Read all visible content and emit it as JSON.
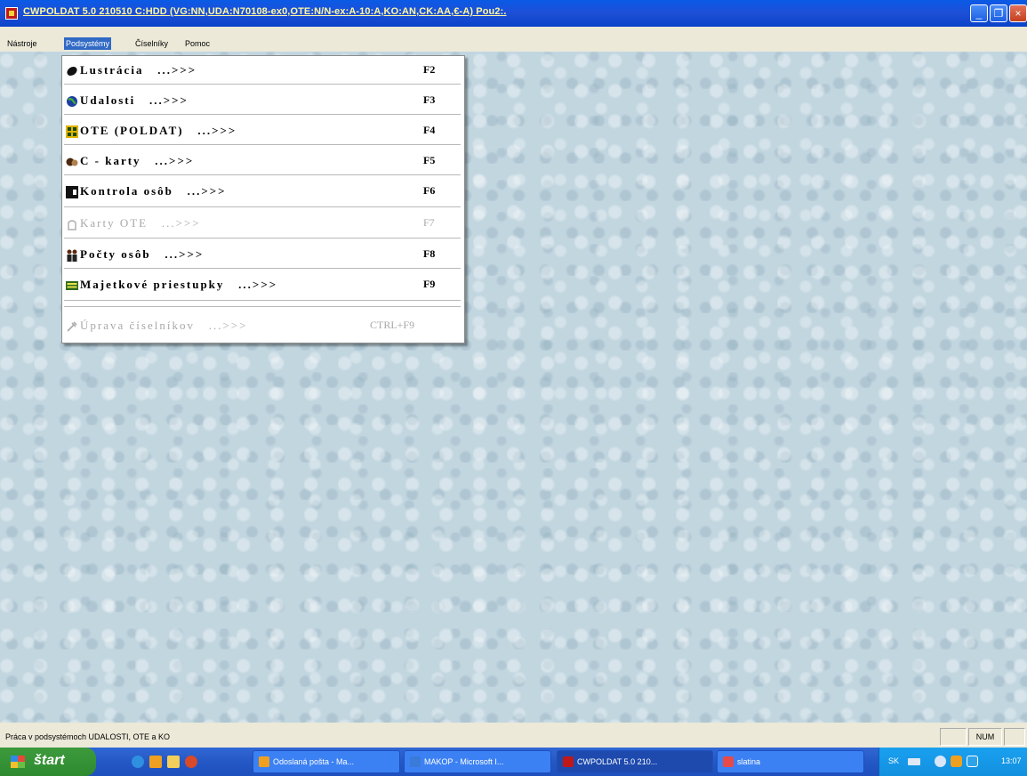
{
  "window": {
    "title": "CWPOLDAT 5.0 210510 C:HDD (VG:NN,UDA:N70108-ex0,OTE:N/N-ex:A-10:A,KO:AN,CK:AA,€-A) Pou2:."
  },
  "menubar": {
    "items": [
      "Nástroje",
      "Podsystémy",
      "Číselníky",
      "Pomoc"
    ],
    "active": "Podsystémy"
  },
  "dropdown": {
    "items": [
      {
        "label": "Lustrácia   ...>>>",
        "shortcut": "F2",
        "icon": "lustracia-icon",
        "enabled": true
      },
      {
        "label": "Udalosti   ...>>>",
        "shortcut": "F3",
        "icon": "globe-icon",
        "enabled": true
      },
      {
        "label": "OTE (POLDAT)   ...>>>",
        "shortcut": "F4",
        "icon": "ote-icon",
        "enabled": true
      },
      {
        "label": "C - karty   ...>>>",
        "shortcut": "F5",
        "icon": "ckarty-icon",
        "enabled": true
      },
      {
        "label": "Kontrola osôb   ...>>>",
        "shortcut": "F6",
        "icon": "kontrola-icon",
        "enabled": true
      },
      {
        "label": "Karty OTE   ...>>>",
        "shortcut": "F7",
        "icon": "karty-ote-icon",
        "enabled": false
      },
      {
        "label": "Počty osôb   ...>>>",
        "shortcut": "F8",
        "icon": "people-icon",
        "enabled": true
      },
      {
        "label": "Majetkové priestupky   ...>>>",
        "shortcut": "F9",
        "icon": "majetkove-icon",
        "enabled": true
      },
      {
        "label": "Úprava číselníkov   ...>>>",
        "shortcut": "CTRL+F9",
        "icon": "uprava-icon",
        "enabled": false
      }
    ]
  },
  "statusbar": {
    "text": "Práca v podsystémoch UDALOSTI, OTE a KO",
    "num": "NUM"
  },
  "taskbar": {
    "start_label": "štart",
    "tasks": [
      {
        "label": "Odoslaná pošta - Ma...",
        "active": false
      },
      {
        "label": "MAKOP - Microsoft I...",
        "active": false
      },
      {
        "label": "CWPOLDAT 5.0 210...",
        "active": true
      },
      {
        "label": "slatina",
        "active": false
      }
    ],
    "language": "SK",
    "clock": "13:07"
  }
}
